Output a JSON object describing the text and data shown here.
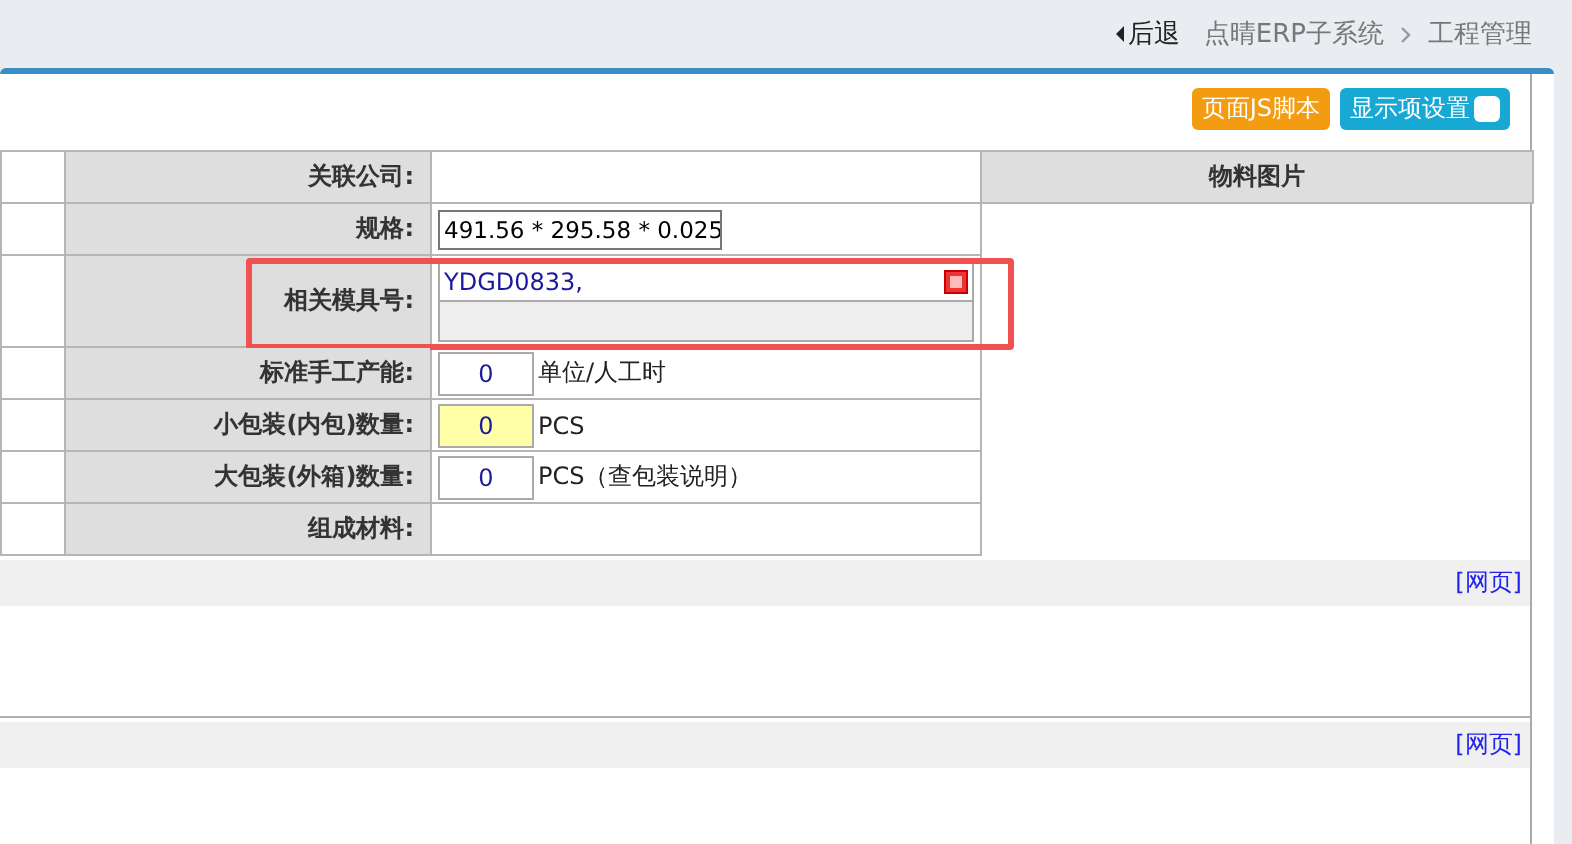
{
  "breadcrumb": {
    "back": "后退",
    "items": [
      "点晴ERP子系统",
      "工程管理"
    ]
  },
  "toolbar": {
    "buttons": [
      {
        "label": "页面JS脚本",
        "kind": "script"
      },
      {
        "label": "显示项设置",
        "kind": "settings",
        "checked": false
      }
    ]
  },
  "form": {
    "image_header": "物料图片",
    "rows": [
      {
        "label": "关联公司:",
        "kind": "empty"
      },
      {
        "label": "规格:",
        "kind": "text",
        "value": "491.56 * 295.58 * 0.025"
      },
      {
        "label": "相关模具号:",
        "kind": "mold",
        "value": "YDGD0833,",
        "annotated": true
      },
      {
        "label": "标准手工产能:",
        "kind": "number",
        "value": "0",
        "unit": "单位/人工时",
        "highlighted": false
      },
      {
        "label": "小包装(内包)数量:",
        "kind": "number",
        "value": "0",
        "unit": "PCS",
        "highlighted": true
      },
      {
        "label": "大包装(外箱)数量:",
        "kind": "number",
        "value": "0",
        "unit": "PCS（查包装说明）",
        "highlighted": false
      },
      {
        "label": "组成材料:",
        "kind": "empty"
      }
    ]
  },
  "sections": [
    {
      "link": "[网页]"
    },
    {
      "link": "[网页]"
    }
  ]
}
